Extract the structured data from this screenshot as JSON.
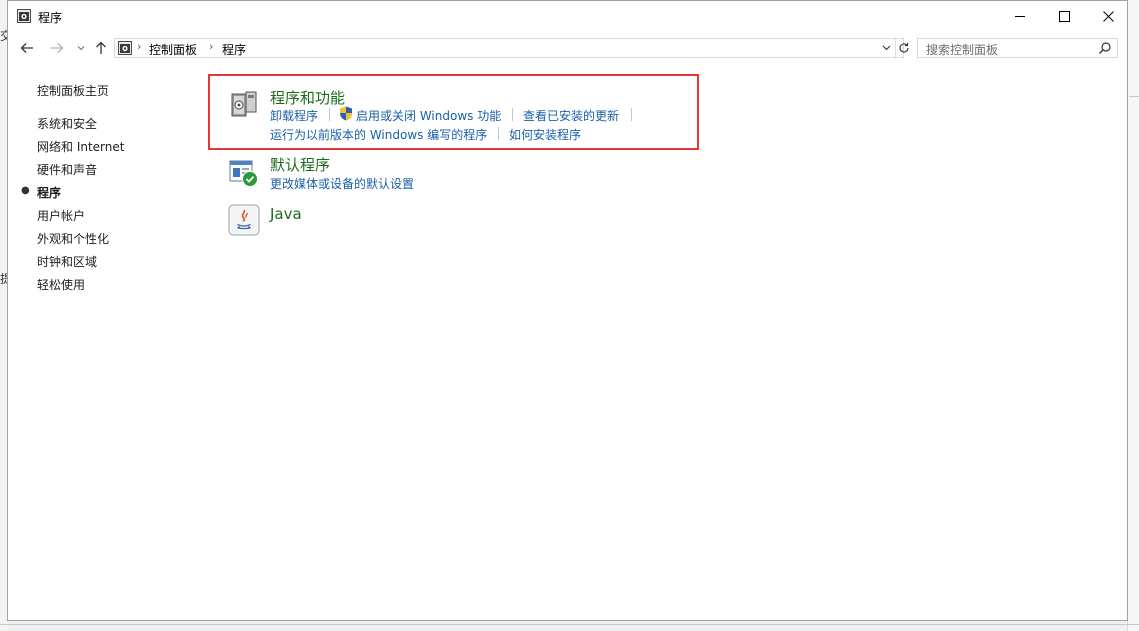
{
  "window": {
    "title": "程序",
    "controls": {
      "minimize": "minimize",
      "maximize": "maximize",
      "close": "close"
    }
  },
  "address_bar": {
    "breadcrumbs": [
      "控制面板",
      "程序"
    ]
  },
  "search": {
    "placeholder": "搜索控制面板"
  },
  "sidebar": {
    "home": "控制面板主页",
    "items": [
      {
        "label": "系统和安全",
        "selected": false
      },
      {
        "label": "网络和 Internet",
        "selected": false
      },
      {
        "label": "硬件和声音",
        "selected": false
      },
      {
        "label": "程序",
        "selected": true
      },
      {
        "label": "用户帐户",
        "selected": false
      },
      {
        "label": "外观和个性化",
        "selected": false
      },
      {
        "label": "时钟和区域",
        "selected": false
      },
      {
        "label": "轻松使用",
        "selected": false
      }
    ]
  },
  "categories": [
    {
      "title": "程序和功能",
      "icon": "programs-features-icon",
      "links_row1": [
        "卸载程序",
        "启用或关闭 Windows 功能",
        "查看已安装的更新"
      ],
      "links_row2": [
        "运行为以前版本的 Windows 编写的程序",
        "如何安装程序"
      ]
    },
    {
      "title": "默认程序",
      "icon": "default-programs-icon",
      "links_row1": [
        "更改媒体或设备的默认设置"
      ]
    },
    {
      "title": "Java",
      "icon": "java-icon"
    }
  ],
  "background_fragments": {
    "left_char_top": "交",
    "left_char_mid": "提"
  },
  "colors": {
    "category_title": "#1e6b1e",
    "link": "#1a5fa9",
    "highlight_border": "#e23a3a"
  }
}
